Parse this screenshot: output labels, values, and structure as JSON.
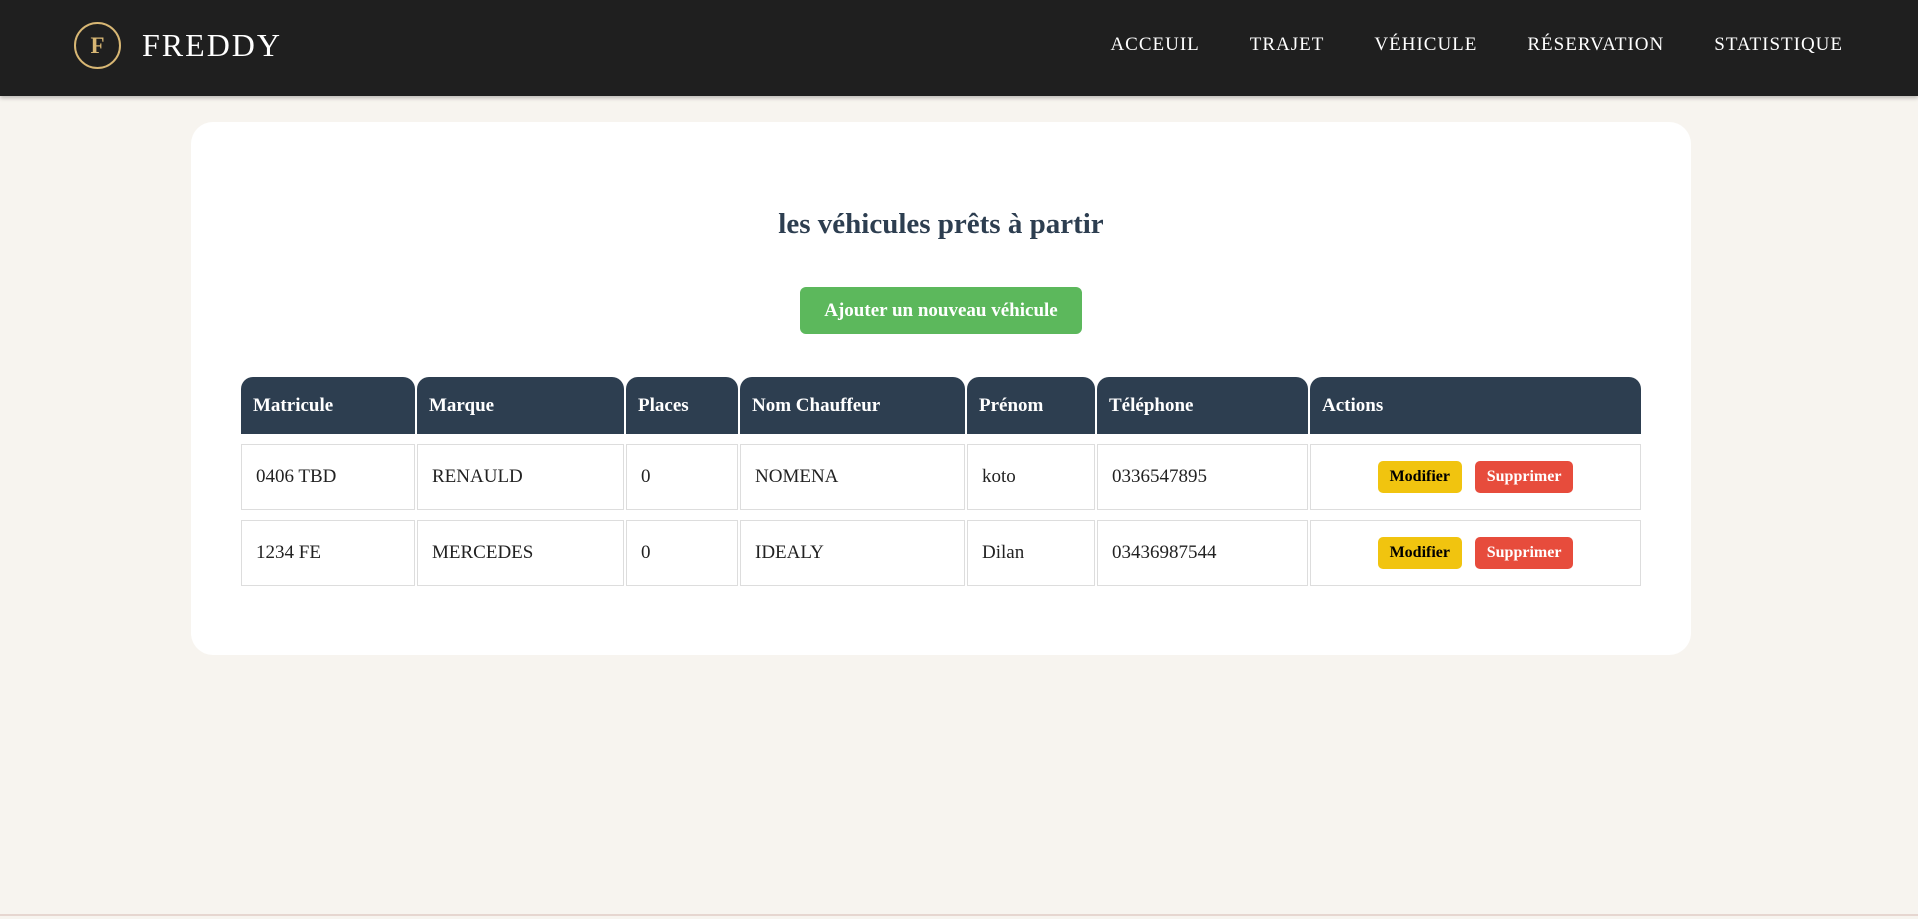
{
  "header": {
    "logo_letter": "F",
    "brand": "FREDDY",
    "nav": [
      "ACCEUIL",
      "TRAJET",
      "VÉHICULE",
      "RÉSERVATION",
      "STATISTIQUE"
    ]
  },
  "main": {
    "title": "les véhicules prêts à partir",
    "add_button": "Ajouter un nouveau véhicule",
    "table": {
      "columns": [
        "Matricule",
        "Marque",
        "Places",
        "Nom Chauffeur",
        "Prénom",
        "Téléphone",
        "Actions"
      ],
      "rows": [
        {
          "matricule": "0406 TBD",
          "marque": "RENAULD",
          "places": "0",
          "nom": "NOMENA",
          "prenom": "koto",
          "telephone": "0336547895"
        },
        {
          "matricule": "1234 FE",
          "marque": "MERCEDES",
          "places": "0",
          "nom": "IDEALY",
          "prenom": "Dilan",
          "telephone": "03436987544"
        }
      ],
      "modify_label": "Modifier",
      "delete_label": "Supprimer"
    }
  },
  "colors": {
    "header_bg": "#1f1f1f",
    "accent_gold": "#d8b774",
    "table_header": "#2d3e50",
    "add_green": "#5cb85c",
    "modify_yellow": "#f1c40f",
    "delete_red": "#e74c3c",
    "page_bg": "#f7f4ef"
  }
}
